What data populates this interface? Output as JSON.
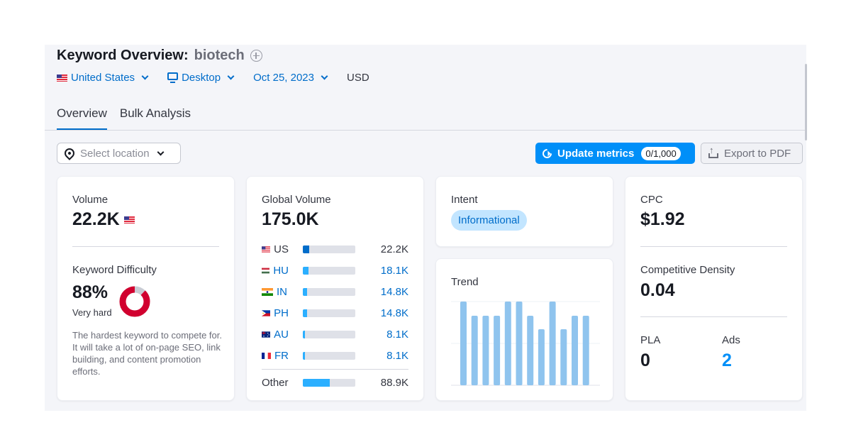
{
  "header": {
    "title": "Keyword Overview:",
    "keyword": "biotech",
    "add_icon": "plus-circle-icon"
  },
  "filters": {
    "country": "United States",
    "country_flag": "us-flag",
    "device": "Desktop",
    "device_icon": "monitor-icon",
    "date": "Oct 25, 2023",
    "currency": "USD"
  },
  "tabs": [
    {
      "label": "Overview",
      "active": true
    },
    {
      "label": "Bulk Analysis",
      "active": false
    }
  ],
  "toolbar": {
    "location_placeholder": "Select location",
    "update_label": "Update metrics",
    "update_badge": "0/1,000",
    "export_label": "Export to PDF",
    "accent_color": "#008ff8"
  },
  "volume": {
    "label": "Volume",
    "value": "22.2K",
    "flag": "us-flag"
  },
  "keyword_difficulty": {
    "label": "Keyword Difficulty",
    "value": "88%",
    "percent": 88,
    "level": "Very hard",
    "description": "The hardest keyword to compete for. It will take a lot of on-page SEO, link building, and content promotion efforts.",
    "color": "#d1002f"
  },
  "global_volume": {
    "label": "Global Volume",
    "value": "175.0K",
    "rows": [
      {
        "code": "US",
        "value": "22.2K",
        "share": 0.127
      },
      {
        "code": "HU",
        "value": "18.1K",
        "share": 0.103
      },
      {
        "code": "IN",
        "value": "14.8K",
        "share": 0.085
      },
      {
        "code": "PH",
        "value": "14.8K",
        "share": 0.085
      },
      {
        "code": "AU",
        "value": "8.1K",
        "share": 0.046
      },
      {
        "code": "FR",
        "value": "8.1K",
        "share": 0.046
      }
    ],
    "other": {
      "label": "Other",
      "value": "88.9K",
      "share": 0.508
    }
  },
  "intent": {
    "label": "Intent",
    "value": "Informational"
  },
  "trend": {
    "label": "Trend",
    "values": [
      1.0,
      0.83,
      0.83,
      0.83,
      1.0,
      1.0,
      0.83,
      0.67,
      1.0,
      0.67,
      0.83,
      0.83
    ]
  },
  "cpc": {
    "label": "CPC",
    "value": "$1.92"
  },
  "competitive_density": {
    "label": "Competitive Density",
    "value": "0.04"
  },
  "pla": {
    "label": "PLA",
    "value": "0"
  },
  "ads": {
    "label": "Ads",
    "value": "2"
  }
}
